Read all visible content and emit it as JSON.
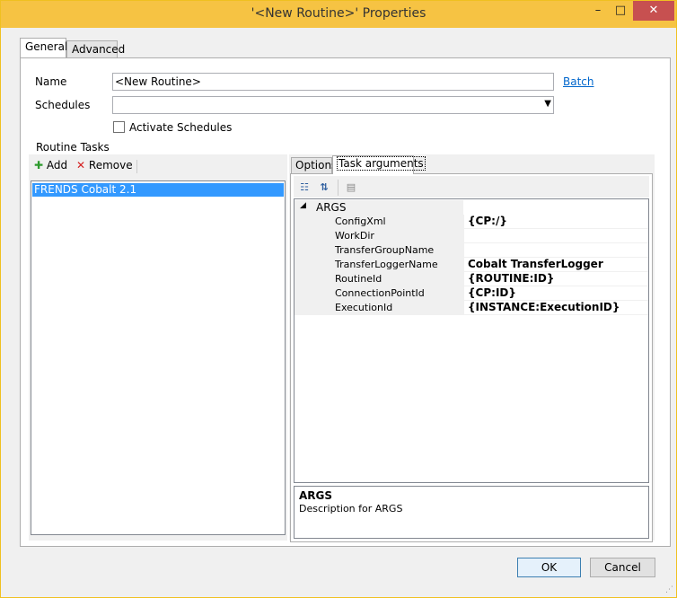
{
  "window": {
    "title": "'<New Routine>' Properties",
    "min_glyph": "–",
    "max_glyph": "□",
    "close_glyph": "✕"
  },
  "tabs": [
    {
      "label": "General",
      "active": true
    },
    {
      "label": "Advanced",
      "active": false
    }
  ],
  "general": {
    "name_label": "Name",
    "name_value": "<New Routine>",
    "batch_link": "Batch",
    "schedules_label": "Schedules",
    "schedules_value": "",
    "activate_label": "Activate Schedules",
    "activate_checked": false
  },
  "routine_tasks": {
    "title": "Routine Tasks",
    "add_label": "Add",
    "remove_label": "Remove",
    "items": [
      "FRENDS Cobalt 2.1"
    ]
  },
  "inner_tabs": [
    {
      "label": "Options",
      "active": false
    },
    {
      "label": "Task arguments",
      "active": true
    }
  ],
  "property_grid": {
    "toolbar": {
      "categorized_icon": "categorized-icon",
      "alphabetical_icon": "alphabetical-icon",
      "pages_icon": "property-pages-icon"
    },
    "category": "ARGS",
    "rows": [
      {
        "name": "ConfigXml",
        "value": "{CP:/}"
      },
      {
        "name": "WorkDir",
        "value": ""
      },
      {
        "name": "TransferGroupName",
        "value": ""
      },
      {
        "name": "TransferLoggerName",
        "value": "Cobalt TransferLogger"
      },
      {
        "name": "RoutineId",
        "value": "{ROUTINE:ID}"
      },
      {
        "name": "ConnectionPointId",
        "value": "{CP:ID}"
      },
      {
        "name": "ExecutionId",
        "value": "{INSTANCE:ExecutionID}"
      }
    ],
    "description_title": "ARGS",
    "description_text": "Description for ARGS"
  },
  "buttons": {
    "ok": "OK",
    "cancel": "Cancel"
  },
  "colors": {
    "titlebar": "#f6c343",
    "selection": "#3399ff",
    "link": "#0066cc",
    "close": "#c75050"
  }
}
